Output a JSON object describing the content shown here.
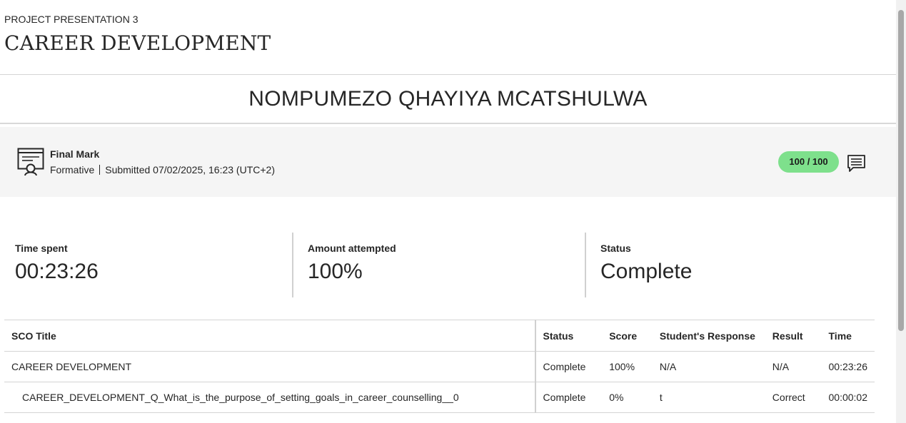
{
  "header": {
    "overline": "PROJECT PRESENTATION 3",
    "title": "CAREER DEVELOPMENT"
  },
  "student": {
    "name": "NOMPUMEZO QHAYIYA MCATSHULWA"
  },
  "final_mark": {
    "icon": "certificate-icon",
    "title": "Final Mark",
    "type": "Formative",
    "submitted": "Submitted 07/02/2025, 16:23 (UTC+2)",
    "score": "100 / 100",
    "score_color": "#7ee08c",
    "feedback_icon": "feedback-icon"
  },
  "stats": {
    "time_spent": {
      "label": "Time spent",
      "value": "00:23:26"
    },
    "amount_attempted": {
      "label": "Amount attempted",
      "value": "100%"
    },
    "status": {
      "label": "Status",
      "value": "Complete"
    }
  },
  "table": {
    "headers": {
      "title": "SCO Title",
      "status": "Status",
      "score": "Score",
      "response": "Student's Response",
      "result": "Result",
      "time": "Time"
    },
    "rows": [
      {
        "title": "CAREER DEVELOPMENT",
        "status": "Complete",
        "score": "100%",
        "response": "N/A",
        "result": "N/A",
        "time": "00:23:26"
      },
      {
        "title": "CAREER_DEVELOPMENT_Q_What_is_the_purpose_of_setting_goals_in_career_counselling__0",
        "status": "Complete",
        "score": "0%",
        "response": "t",
        "result": "Correct",
        "time": "00:00:02"
      }
    ]
  }
}
